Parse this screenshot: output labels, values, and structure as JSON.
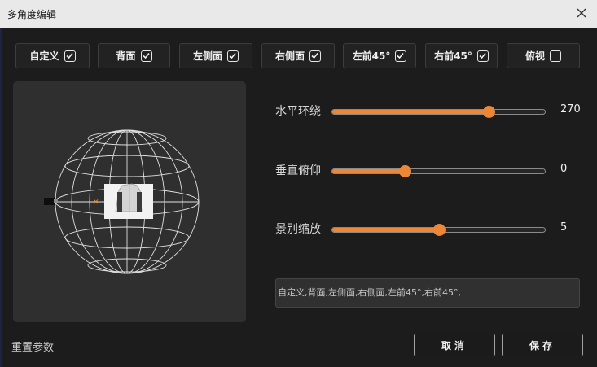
{
  "window": {
    "title": "多角度编辑"
  },
  "views": [
    {
      "label": "自定义",
      "checked": true,
      "active": true
    },
    {
      "label": "背面",
      "checked": true,
      "active": false
    },
    {
      "label": "左侧面",
      "checked": true,
      "active": false
    },
    {
      "label": "右侧面",
      "checked": true,
      "active": false
    },
    {
      "label": "左前45°",
      "checked": true,
      "active": false
    },
    {
      "label": "右前45°",
      "checked": true,
      "active": false
    },
    {
      "label": "俯视",
      "checked": false,
      "active": false
    }
  ],
  "sliders": [
    {
      "label": "水平环绕",
      "value": "270",
      "fraction": 0.735
    },
    {
      "label": "垂直俯仰",
      "value": "0",
      "fraction": 0.34
    },
    {
      "label": "景别缩放",
      "value": "5",
      "fraction": 0.5
    }
  ],
  "summary": {
    "text": "自定义,背面,左侧面,右侧面,左前45°,右前45°,"
  },
  "footer": {
    "reset": "重置参数",
    "cancel": "取消",
    "save": "保存"
  },
  "colors": {
    "accent": "#ec8738",
    "background": "#1c1c1c",
    "titlebar": "#e9e9e9"
  },
  "icons": {
    "close": "close-icon",
    "check": "checkbox-check-icon"
  }
}
